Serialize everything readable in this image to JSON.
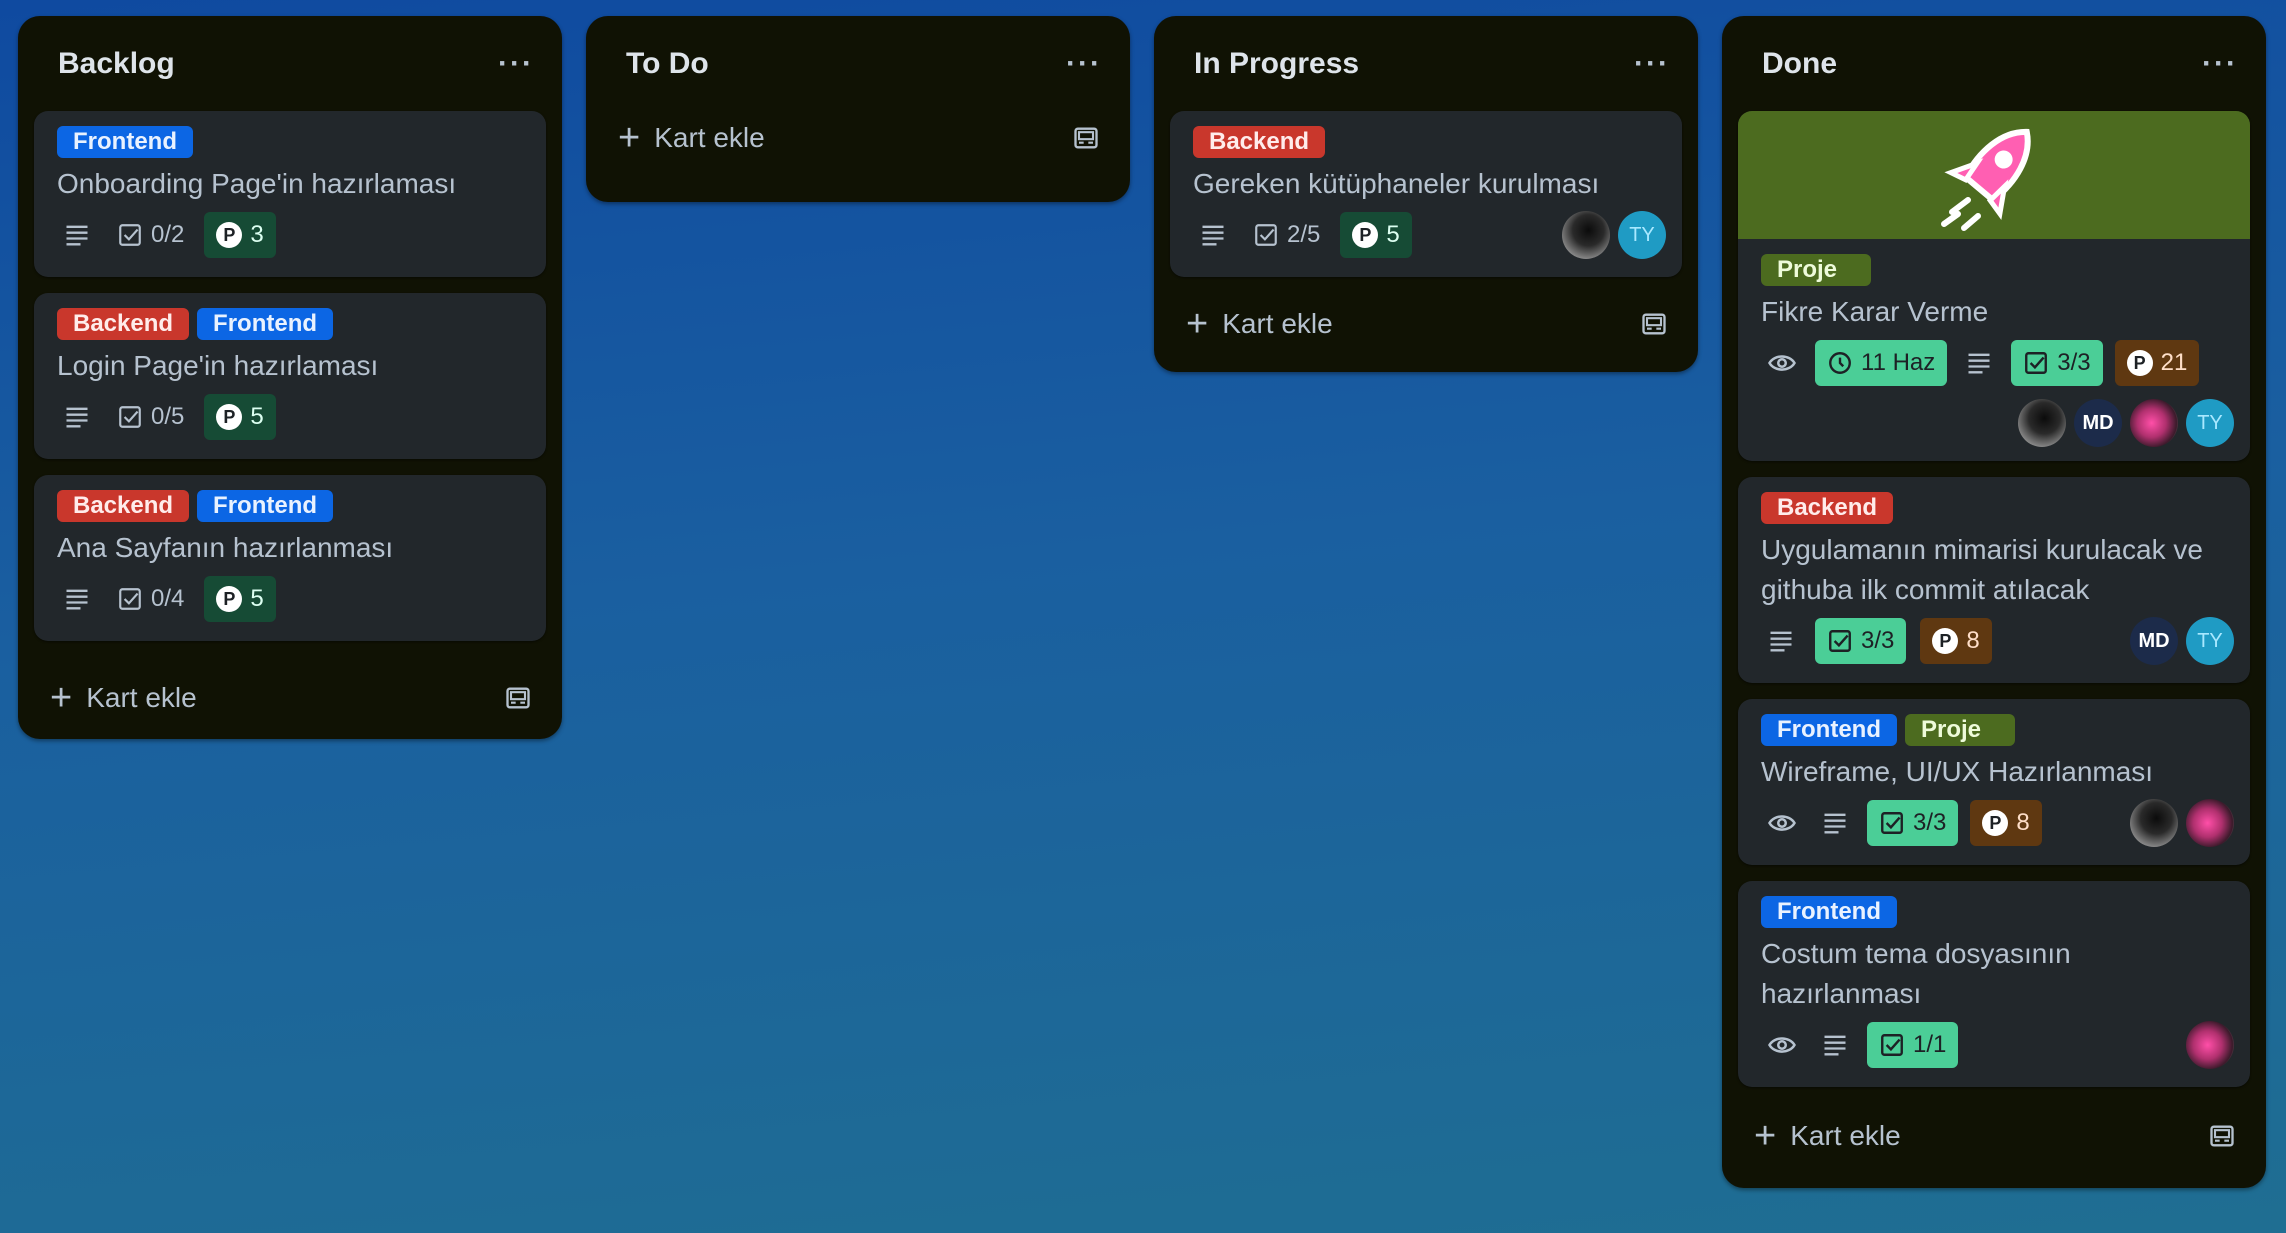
{
  "lists": [
    {
      "title": "Backlog",
      "cards": [
        {
          "labels": [
            {
              "text": "Frontend",
              "color": "#0c66e4"
            }
          ],
          "title": "Onboarding Page'in hazırlaması",
          "checklist": "0/2",
          "points": "3"
        },
        {
          "labels": [
            {
              "text": "Backend",
              "color": "#c9372c"
            },
            {
              "text": "Frontend",
              "color": "#0c66e4"
            }
          ],
          "title": "Login Page'in hazırlaması",
          "checklist": "0/5",
          "points": "5"
        },
        {
          "labels": [
            {
              "text": "Backend",
              "color": "#c9372c"
            },
            {
              "text": "Frontend",
              "color": "#0c66e4"
            }
          ],
          "title": "Ana Sayfanın hazırlanması",
          "checklist": "0/4",
          "points": "5"
        }
      ],
      "add_card": "Kart ekle"
    },
    {
      "title": "To Do",
      "cards": [],
      "add_card": "Kart ekle"
    },
    {
      "title": "In Progress",
      "cards": [
        {
          "labels": [
            {
              "text": "Backend",
              "color": "#c9372c"
            }
          ],
          "title": "Gereken kütüphaneler kurulması",
          "checklist": "2/5",
          "points": "5",
          "members": [
            "photo",
            "TY"
          ]
        }
      ],
      "add_card": "Kart ekle"
    },
    {
      "title": "Done",
      "cards": [
        {
          "cover_color": "#4c6b1f",
          "cover_icon": "rocket-sticker",
          "labels": [
            {
              "text": "Proje",
              "color": "#4c6b1f"
            }
          ],
          "title": "Fikre Karar Verme",
          "due": "11 Haz",
          "checklist": "3/3",
          "points": "21",
          "members": [
            "photo",
            "MD",
            "photo-pink",
            "TY"
          ]
        },
        {
          "labels": [
            {
              "text": "Backend",
              "color": "#c9372c"
            }
          ],
          "title": "Uygulamanın mimarisi kurulacak ve githuba ilk commit atılacak",
          "checklist": "3/3",
          "points": "8",
          "members": [
            "MD",
            "TY"
          ]
        },
        {
          "labels": [
            {
              "text": "Frontend",
              "color": "#0c66e4"
            },
            {
              "text": "Proje",
              "color": "#4c6b1f"
            }
          ],
          "title": "Wireframe, UI/UX Hazırlanması",
          "checklist": "3/3",
          "points": "8",
          "members": [
            "photo",
            "photo-pink"
          ]
        },
        {
          "labels": [
            {
              "text": "Frontend",
              "color": "#0c66e4"
            }
          ],
          "title": "Costum tema dosyasının hazırlanması",
          "checklist": "1/1",
          "members": [
            "photo-pink"
          ]
        }
      ],
      "add_card": "Kart ekle"
    }
  ],
  "list_menu_label": "···",
  "member_initials": {
    "ty": "TY",
    "md": "MD"
  },
  "icons": [
    "description-icon",
    "checklist-icon",
    "points-icon",
    "watch-icon",
    "clock-icon",
    "plus-icon",
    "template-icon",
    "more-icon"
  ],
  "colors": {
    "list_bg": "#101204",
    "card_bg": "#22272b",
    "complete_badge": "#4bce97",
    "points_green": "#164b35",
    "points_orange": "#5f3811"
  }
}
